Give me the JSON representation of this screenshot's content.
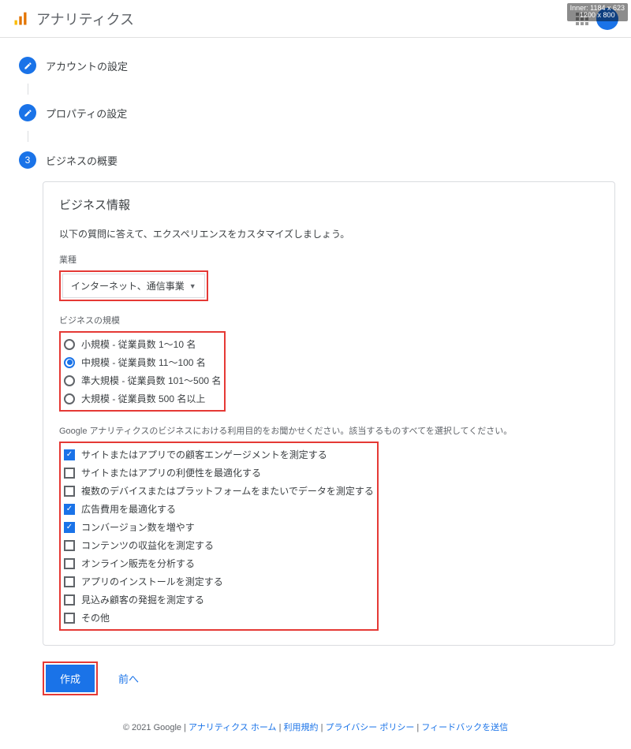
{
  "header": {
    "title": "アナリティクス",
    "dim_badge": "Inner: 1184 x 623\n1200 x 800"
  },
  "stepper": {
    "step1": "アカウントの設定",
    "step2": "プロパティの設定",
    "step3_num": "3",
    "step3": "ビジネスの概要"
  },
  "card": {
    "title": "ビジネス情報",
    "desc": "以下の質問に答えて、エクスペリエンスをカスタマイズしましょう。",
    "industry_label": "業種",
    "industry_value": "インターネット、通信事業",
    "size_label": "ビジネスの規模",
    "sizes": [
      {
        "label": "小規模 - 従業員数 1～10 名",
        "selected": false
      },
      {
        "label": "中規模 - 従業員数 11～100 名",
        "selected": true
      },
      {
        "label": "準大規模 - 従業員数 101～500 名",
        "selected": false
      },
      {
        "label": "大規模 - 従業員数 500 名以上",
        "selected": false
      }
    ],
    "purpose_label": "Google アナリティクスのビジネスにおける利用目的をお聞かせください。該当するものすべてを選択してください。",
    "purposes": [
      {
        "label": "サイトまたはアプリでの顧客エンゲージメントを測定する",
        "checked": true
      },
      {
        "label": "サイトまたはアプリの利便性を最適化する",
        "checked": false
      },
      {
        "label": "複数のデバイスまたはプラットフォームをまたいでデータを測定する",
        "checked": false
      },
      {
        "label": "広告費用を最適化する",
        "checked": true
      },
      {
        "label": "コンバージョン数を増やす",
        "checked": true
      },
      {
        "label": "コンテンツの収益化を測定する",
        "checked": false
      },
      {
        "label": "オンライン販売を分析する",
        "checked": false
      },
      {
        "label": "アプリのインストールを測定する",
        "checked": false
      },
      {
        "label": "見込み顧客の発掘を測定する",
        "checked": false
      },
      {
        "label": "その他",
        "checked": false
      }
    ]
  },
  "buttons": {
    "create": "作成",
    "prev": "前へ"
  },
  "footer": {
    "copyright": "© 2021 Google",
    "home": "アナリティクス ホーム",
    "terms": "利用規約",
    "privacy": "プライバシー ポリシー",
    "feedback": "フィードバックを送信"
  }
}
